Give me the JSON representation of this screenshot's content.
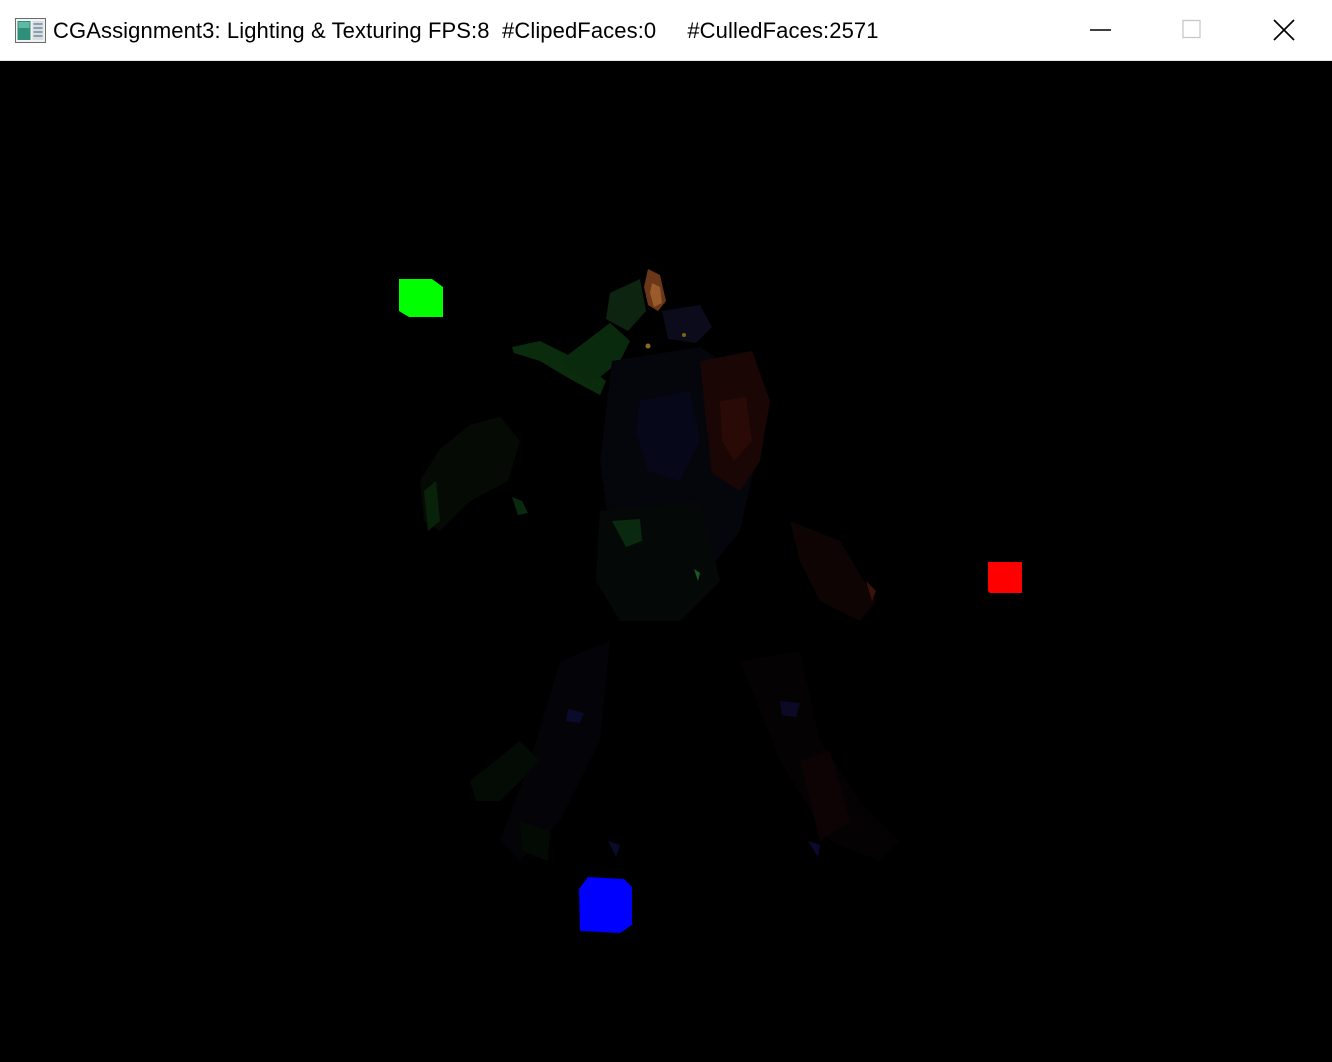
{
  "window": {
    "title": "CGAssignment3: Lighting & Texturing FPS:8  #ClipedFaces:0     #CulledFaces:2571",
    "icon": "application-window-icon",
    "controls": {
      "minimize": "minimize-icon",
      "maximize": "maximize-icon",
      "close": "close-icon"
    }
  },
  "scene": {
    "background": "#000000",
    "lights": [
      {
        "name": "green-light-cube",
        "color": "#00ff00"
      },
      {
        "name": "red-light-cube",
        "color": "#ff0000"
      },
      {
        "name": "blue-light-cube",
        "color": "#0000ff"
      }
    ],
    "model": {
      "name": "dim-lit-character-model"
    }
  }
}
